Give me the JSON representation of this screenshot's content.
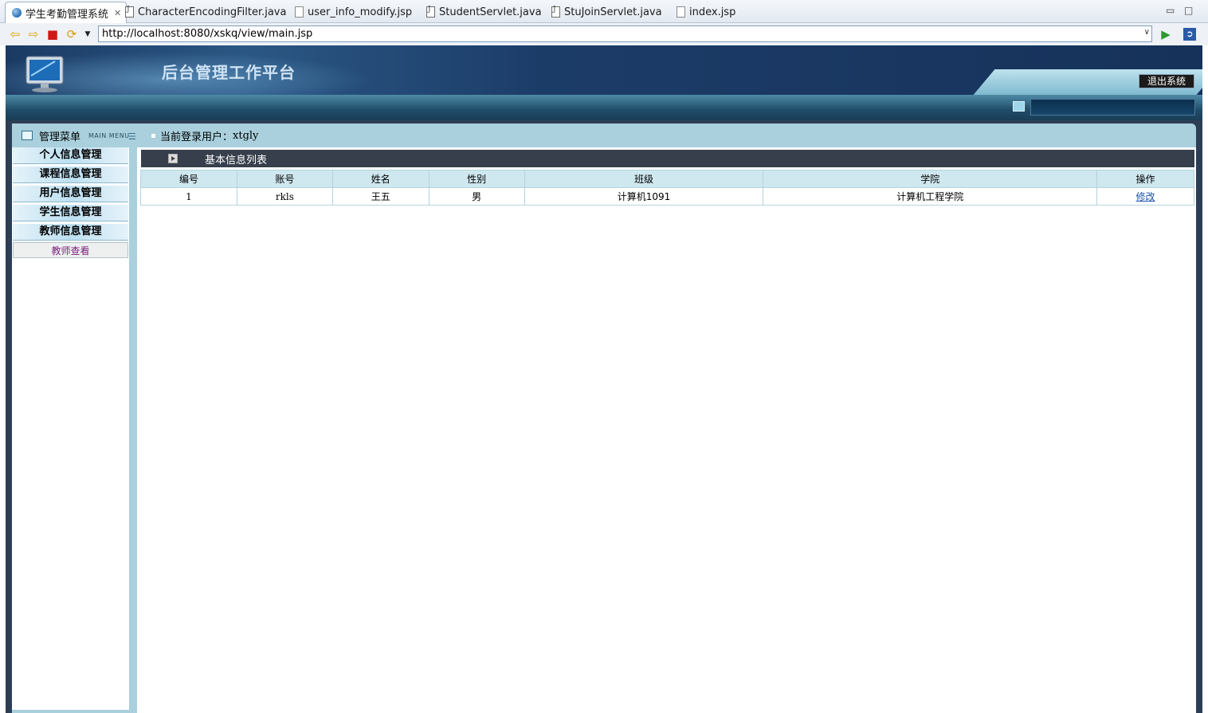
{
  "tabs": [
    {
      "label": "学生考勤管理系统",
      "icon": "globe-icon",
      "active": true
    },
    {
      "label": "CharacterEncodingFilter.java",
      "icon": "java-file-icon"
    },
    {
      "label": "user_info_modify.jsp",
      "icon": "jsp-file-icon"
    },
    {
      "label": "StudentServlet.java",
      "icon": "java-file-icon"
    },
    {
      "label": "StuJoinServlet.java",
      "icon": "java-file-icon"
    },
    {
      "label": "index.jsp",
      "icon": "jsp-file-icon"
    }
  ],
  "browser": {
    "url": "http://localhost:8080/xskq/view/main.jsp"
  },
  "header": {
    "title": "后台管理工作平台",
    "logout_label": "退出系统"
  },
  "menu": {
    "title": "管理菜单",
    "subtitle": "MAIN MENU",
    "items": [
      "个人信息管理",
      "课程信息管理",
      "用户信息管理",
      "学生信息管理",
      "教师信息管理"
    ],
    "sub_item": "教师查看"
  },
  "current_user": {
    "label": "当前登录用户：",
    "value": "xtgly"
  },
  "list": {
    "title": "基本信息列表",
    "columns": [
      "编号",
      "账号",
      "姓名",
      "性别",
      "班级",
      "学院",
      "操作"
    ],
    "rows": [
      {
        "id": "1",
        "account": "rkls",
        "name": "王五",
        "gender": "男",
        "class": "计算机1091",
        "college": "计算机工程学院",
        "action": "修改"
      }
    ]
  },
  "colors": {
    "banner": "#1c3c68",
    "menu_bg": "#a9d0dc",
    "list_header": "#363f4b",
    "link": "#1a52b0"
  }
}
